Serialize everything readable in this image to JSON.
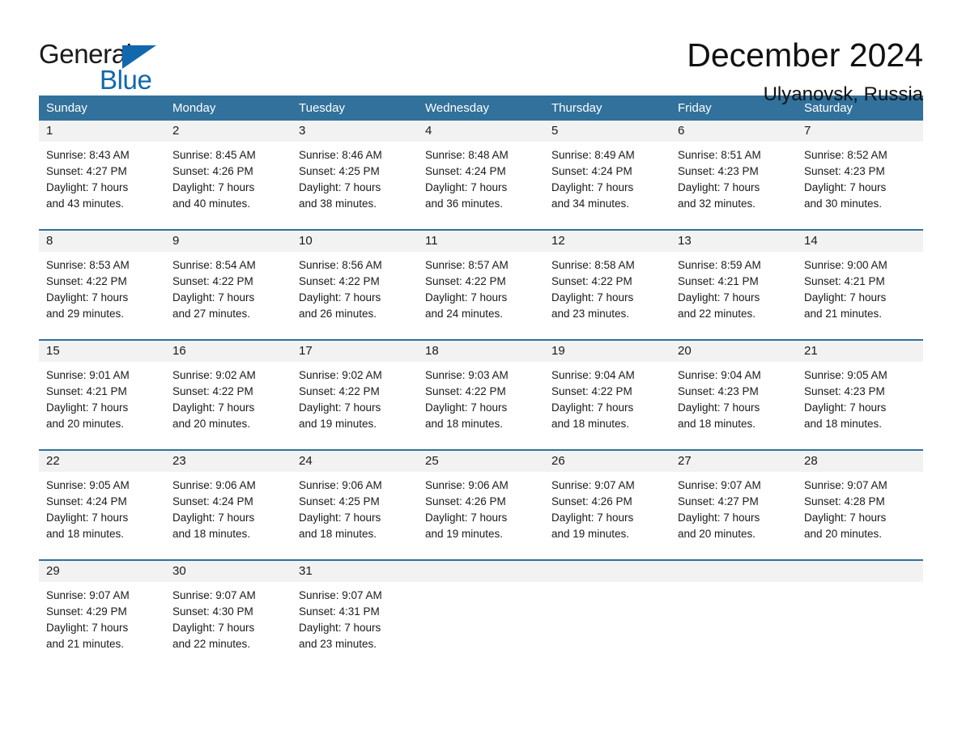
{
  "brand": {
    "name_part1": "General",
    "name_part2": "Blue",
    "accent_color": "#1268ad",
    "triangle_icon": "triangle-icon"
  },
  "header": {
    "title": "December 2024",
    "location": "Ulyanovsk, Russia"
  },
  "theme": {
    "header_row_color": "#31719b",
    "day_band_color": "#f2f2f2",
    "row_divider_color": "#31719b",
    "text_color": "#1a1a1a"
  },
  "weekdays": [
    "Sunday",
    "Monday",
    "Tuesday",
    "Wednesday",
    "Thursday",
    "Friday",
    "Saturday"
  ],
  "weeks": [
    [
      {
        "day": "1",
        "sunrise": "Sunrise: 8:43 AM",
        "sunset": "Sunset: 4:27 PM",
        "daylight1": "Daylight: 7 hours",
        "daylight2": "and 43 minutes."
      },
      {
        "day": "2",
        "sunrise": "Sunrise: 8:45 AM",
        "sunset": "Sunset: 4:26 PM",
        "daylight1": "Daylight: 7 hours",
        "daylight2": "and 40 minutes."
      },
      {
        "day": "3",
        "sunrise": "Sunrise: 8:46 AM",
        "sunset": "Sunset: 4:25 PM",
        "daylight1": "Daylight: 7 hours",
        "daylight2": "and 38 minutes."
      },
      {
        "day": "4",
        "sunrise": "Sunrise: 8:48 AM",
        "sunset": "Sunset: 4:24 PM",
        "daylight1": "Daylight: 7 hours",
        "daylight2": "and 36 minutes."
      },
      {
        "day": "5",
        "sunrise": "Sunrise: 8:49 AM",
        "sunset": "Sunset: 4:24 PM",
        "daylight1": "Daylight: 7 hours",
        "daylight2": "and 34 minutes."
      },
      {
        "day": "6",
        "sunrise": "Sunrise: 8:51 AM",
        "sunset": "Sunset: 4:23 PM",
        "daylight1": "Daylight: 7 hours",
        "daylight2": "and 32 minutes."
      },
      {
        "day": "7",
        "sunrise": "Sunrise: 8:52 AM",
        "sunset": "Sunset: 4:23 PM",
        "daylight1": "Daylight: 7 hours",
        "daylight2": "and 30 minutes."
      }
    ],
    [
      {
        "day": "8",
        "sunrise": "Sunrise: 8:53 AM",
        "sunset": "Sunset: 4:22 PM",
        "daylight1": "Daylight: 7 hours",
        "daylight2": "and 29 minutes."
      },
      {
        "day": "9",
        "sunrise": "Sunrise: 8:54 AM",
        "sunset": "Sunset: 4:22 PM",
        "daylight1": "Daylight: 7 hours",
        "daylight2": "and 27 minutes."
      },
      {
        "day": "10",
        "sunrise": "Sunrise: 8:56 AM",
        "sunset": "Sunset: 4:22 PM",
        "daylight1": "Daylight: 7 hours",
        "daylight2": "and 26 minutes."
      },
      {
        "day": "11",
        "sunrise": "Sunrise: 8:57 AM",
        "sunset": "Sunset: 4:22 PM",
        "daylight1": "Daylight: 7 hours",
        "daylight2": "and 24 minutes."
      },
      {
        "day": "12",
        "sunrise": "Sunrise: 8:58 AM",
        "sunset": "Sunset: 4:22 PM",
        "daylight1": "Daylight: 7 hours",
        "daylight2": "and 23 minutes."
      },
      {
        "day": "13",
        "sunrise": "Sunrise: 8:59 AM",
        "sunset": "Sunset: 4:21 PM",
        "daylight1": "Daylight: 7 hours",
        "daylight2": "and 22 minutes."
      },
      {
        "day": "14",
        "sunrise": "Sunrise: 9:00 AM",
        "sunset": "Sunset: 4:21 PM",
        "daylight1": "Daylight: 7 hours",
        "daylight2": "and 21 minutes."
      }
    ],
    [
      {
        "day": "15",
        "sunrise": "Sunrise: 9:01 AM",
        "sunset": "Sunset: 4:21 PM",
        "daylight1": "Daylight: 7 hours",
        "daylight2": "and 20 minutes."
      },
      {
        "day": "16",
        "sunrise": "Sunrise: 9:02 AM",
        "sunset": "Sunset: 4:22 PM",
        "daylight1": "Daylight: 7 hours",
        "daylight2": "and 20 minutes."
      },
      {
        "day": "17",
        "sunrise": "Sunrise: 9:02 AM",
        "sunset": "Sunset: 4:22 PM",
        "daylight1": "Daylight: 7 hours",
        "daylight2": "and 19 minutes."
      },
      {
        "day": "18",
        "sunrise": "Sunrise: 9:03 AM",
        "sunset": "Sunset: 4:22 PM",
        "daylight1": "Daylight: 7 hours",
        "daylight2": "and 18 minutes."
      },
      {
        "day": "19",
        "sunrise": "Sunrise: 9:04 AM",
        "sunset": "Sunset: 4:22 PM",
        "daylight1": "Daylight: 7 hours",
        "daylight2": "and 18 minutes."
      },
      {
        "day": "20",
        "sunrise": "Sunrise: 9:04 AM",
        "sunset": "Sunset: 4:23 PM",
        "daylight1": "Daylight: 7 hours",
        "daylight2": "and 18 minutes."
      },
      {
        "day": "21",
        "sunrise": "Sunrise: 9:05 AM",
        "sunset": "Sunset: 4:23 PM",
        "daylight1": "Daylight: 7 hours",
        "daylight2": "and 18 minutes."
      }
    ],
    [
      {
        "day": "22",
        "sunrise": "Sunrise: 9:05 AM",
        "sunset": "Sunset: 4:24 PM",
        "daylight1": "Daylight: 7 hours",
        "daylight2": "and 18 minutes."
      },
      {
        "day": "23",
        "sunrise": "Sunrise: 9:06 AM",
        "sunset": "Sunset: 4:24 PM",
        "daylight1": "Daylight: 7 hours",
        "daylight2": "and 18 minutes."
      },
      {
        "day": "24",
        "sunrise": "Sunrise: 9:06 AM",
        "sunset": "Sunset: 4:25 PM",
        "daylight1": "Daylight: 7 hours",
        "daylight2": "and 18 minutes."
      },
      {
        "day": "25",
        "sunrise": "Sunrise: 9:06 AM",
        "sunset": "Sunset: 4:26 PM",
        "daylight1": "Daylight: 7 hours",
        "daylight2": "and 19 minutes."
      },
      {
        "day": "26",
        "sunrise": "Sunrise: 9:07 AM",
        "sunset": "Sunset: 4:26 PM",
        "daylight1": "Daylight: 7 hours",
        "daylight2": "and 19 minutes."
      },
      {
        "day": "27",
        "sunrise": "Sunrise: 9:07 AM",
        "sunset": "Sunset: 4:27 PM",
        "daylight1": "Daylight: 7 hours",
        "daylight2": "and 20 minutes."
      },
      {
        "day": "28",
        "sunrise": "Sunrise: 9:07 AM",
        "sunset": "Sunset: 4:28 PM",
        "daylight1": "Daylight: 7 hours",
        "daylight2": "and 20 minutes."
      }
    ],
    [
      {
        "day": "29",
        "sunrise": "Sunrise: 9:07 AM",
        "sunset": "Sunset: 4:29 PM",
        "daylight1": "Daylight: 7 hours",
        "daylight2": "and 21 minutes."
      },
      {
        "day": "30",
        "sunrise": "Sunrise: 9:07 AM",
        "sunset": "Sunset: 4:30 PM",
        "daylight1": "Daylight: 7 hours",
        "daylight2": "and 22 minutes."
      },
      {
        "day": "31",
        "sunrise": "Sunrise: 9:07 AM",
        "sunset": "Sunset: 4:31 PM",
        "daylight1": "Daylight: 7 hours",
        "daylight2": "and 23 minutes."
      },
      {
        "day": "",
        "sunrise": "",
        "sunset": "",
        "daylight1": "",
        "daylight2": ""
      },
      {
        "day": "",
        "sunrise": "",
        "sunset": "",
        "daylight1": "",
        "daylight2": ""
      },
      {
        "day": "",
        "sunrise": "",
        "sunset": "",
        "daylight1": "",
        "daylight2": ""
      },
      {
        "day": "",
        "sunrise": "",
        "sunset": "",
        "daylight1": "",
        "daylight2": ""
      }
    ]
  ]
}
